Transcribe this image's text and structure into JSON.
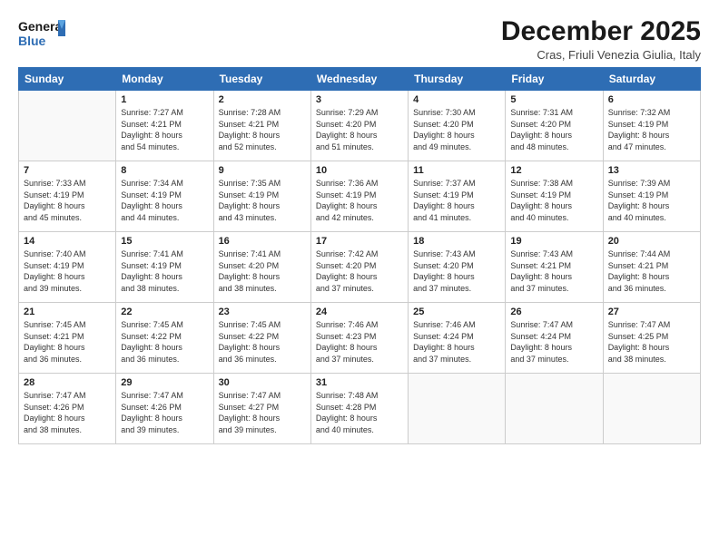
{
  "logo": {
    "line1": "General",
    "line2": "Blue"
  },
  "title": "December 2025",
  "subtitle": "Cras, Friuli Venezia Giulia, Italy",
  "weekdays": [
    "Sunday",
    "Monday",
    "Tuesday",
    "Wednesday",
    "Thursday",
    "Friday",
    "Saturday"
  ],
  "weeks": [
    [
      {
        "day": "",
        "info": ""
      },
      {
        "day": "1",
        "info": "Sunrise: 7:27 AM\nSunset: 4:21 PM\nDaylight: 8 hours\nand 54 minutes."
      },
      {
        "day": "2",
        "info": "Sunrise: 7:28 AM\nSunset: 4:21 PM\nDaylight: 8 hours\nand 52 minutes."
      },
      {
        "day": "3",
        "info": "Sunrise: 7:29 AM\nSunset: 4:20 PM\nDaylight: 8 hours\nand 51 minutes."
      },
      {
        "day": "4",
        "info": "Sunrise: 7:30 AM\nSunset: 4:20 PM\nDaylight: 8 hours\nand 49 minutes."
      },
      {
        "day": "5",
        "info": "Sunrise: 7:31 AM\nSunset: 4:20 PM\nDaylight: 8 hours\nand 48 minutes."
      },
      {
        "day": "6",
        "info": "Sunrise: 7:32 AM\nSunset: 4:19 PM\nDaylight: 8 hours\nand 47 minutes."
      }
    ],
    [
      {
        "day": "7",
        "info": "Sunrise: 7:33 AM\nSunset: 4:19 PM\nDaylight: 8 hours\nand 45 minutes."
      },
      {
        "day": "8",
        "info": "Sunrise: 7:34 AM\nSunset: 4:19 PM\nDaylight: 8 hours\nand 44 minutes."
      },
      {
        "day": "9",
        "info": "Sunrise: 7:35 AM\nSunset: 4:19 PM\nDaylight: 8 hours\nand 43 minutes."
      },
      {
        "day": "10",
        "info": "Sunrise: 7:36 AM\nSunset: 4:19 PM\nDaylight: 8 hours\nand 42 minutes."
      },
      {
        "day": "11",
        "info": "Sunrise: 7:37 AM\nSunset: 4:19 PM\nDaylight: 8 hours\nand 41 minutes."
      },
      {
        "day": "12",
        "info": "Sunrise: 7:38 AM\nSunset: 4:19 PM\nDaylight: 8 hours\nand 40 minutes."
      },
      {
        "day": "13",
        "info": "Sunrise: 7:39 AM\nSunset: 4:19 PM\nDaylight: 8 hours\nand 40 minutes."
      }
    ],
    [
      {
        "day": "14",
        "info": "Sunrise: 7:40 AM\nSunset: 4:19 PM\nDaylight: 8 hours\nand 39 minutes."
      },
      {
        "day": "15",
        "info": "Sunrise: 7:41 AM\nSunset: 4:19 PM\nDaylight: 8 hours\nand 38 minutes."
      },
      {
        "day": "16",
        "info": "Sunrise: 7:41 AM\nSunset: 4:20 PM\nDaylight: 8 hours\nand 38 minutes."
      },
      {
        "day": "17",
        "info": "Sunrise: 7:42 AM\nSunset: 4:20 PM\nDaylight: 8 hours\nand 37 minutes."
      },
      {
        "day": "18",
        "info": "Sunrise: 7:43 AM\nSunset: 4:20 PM\nDaylight: 8 hours\nand 37 minutes."
      },
      {
        "day": "19",
        "info": "Sunrise: 7:43 AM\nSunset: 4:21 PM\nDaylight: 8 hours\nand 37 minutes."
      },
      {
        "day": "20",
        "info": "Sunrise: 7:44 AM\nSunset: 4:21 PM\nDaylight: 8 hours\nand 36 minutes."
      }
    ],
    [
      {
        "day": "21",
        "info": "Sunrise: 7:45 AM\nSunset: 4:21 PM\nDaylight: 8 hours\nand 36 minutes."
      },
      {
        "day": "22",
        "info": "Sunrise: 7:45 AM\nSunset: 4:22 PM\nDaylight: 8 hours\nand 36 minutes."
      },
      {
        "day": "23",
        "info": "Sunrise: 7:45 AM\nSunset: 4:22 PM\nDaylight: 8 hours\nand 36 minutes."
      },
      {
        "day": "24",
        "info": "Sunrise: 7:46 AM\nSunset: 4:23 PM\nDaylight: 8 hours\nand 37 minutes."
      },
      {
        "day": "25",
        "info": "Sunrise: 7:46 AM\nSunset: 4:24 PM\nDaylight: 8 hours\nand 37 minutes."
      },
      {
        "day": "26",
        "info": "Sunrise: 7:47 AM\nSunset: 4:24 PM\nDaylight: 8 hours\nand 37 minutes."
      },
      {
        "day": "27",
        "info": "Sunrise: 7:47 AM\nSunset: 4:25 PM\nDaylight: 8 hours\nand 38 minutes."
      }
    ],
    [
      {
        "day": "28",
        "info": "Sunrise: 7:47 AM\nSunset: 4:26 PM\nDaylight: 8 hours\nand 38 minutes."
      },
      {
        "day": "29",
        "info": "Sunrise: 7:47 AM\nSunset: 4:26 PM\nDaylight: 8 hours\nand 39 minutes."
      },
      {
        "day": "30",
        "info": "Sunrise: 7:47 AM\nSunset: 4:27 PM\nDaylight: 8 hours\nand 39 minutes."
      },
      {
        "day": "31",
        "info": "Sunrise: 7:48 AM\nSunset: 4:28 PM\nDaylight: 8 hours\nand 40 minutes."
      },
      {
        "day": "",
        "info": ""
      },
      {
        "day": "",
        "info": ""
      },
      {
        "day": "",
        "info": ""
      }
    ]
  ]
}
